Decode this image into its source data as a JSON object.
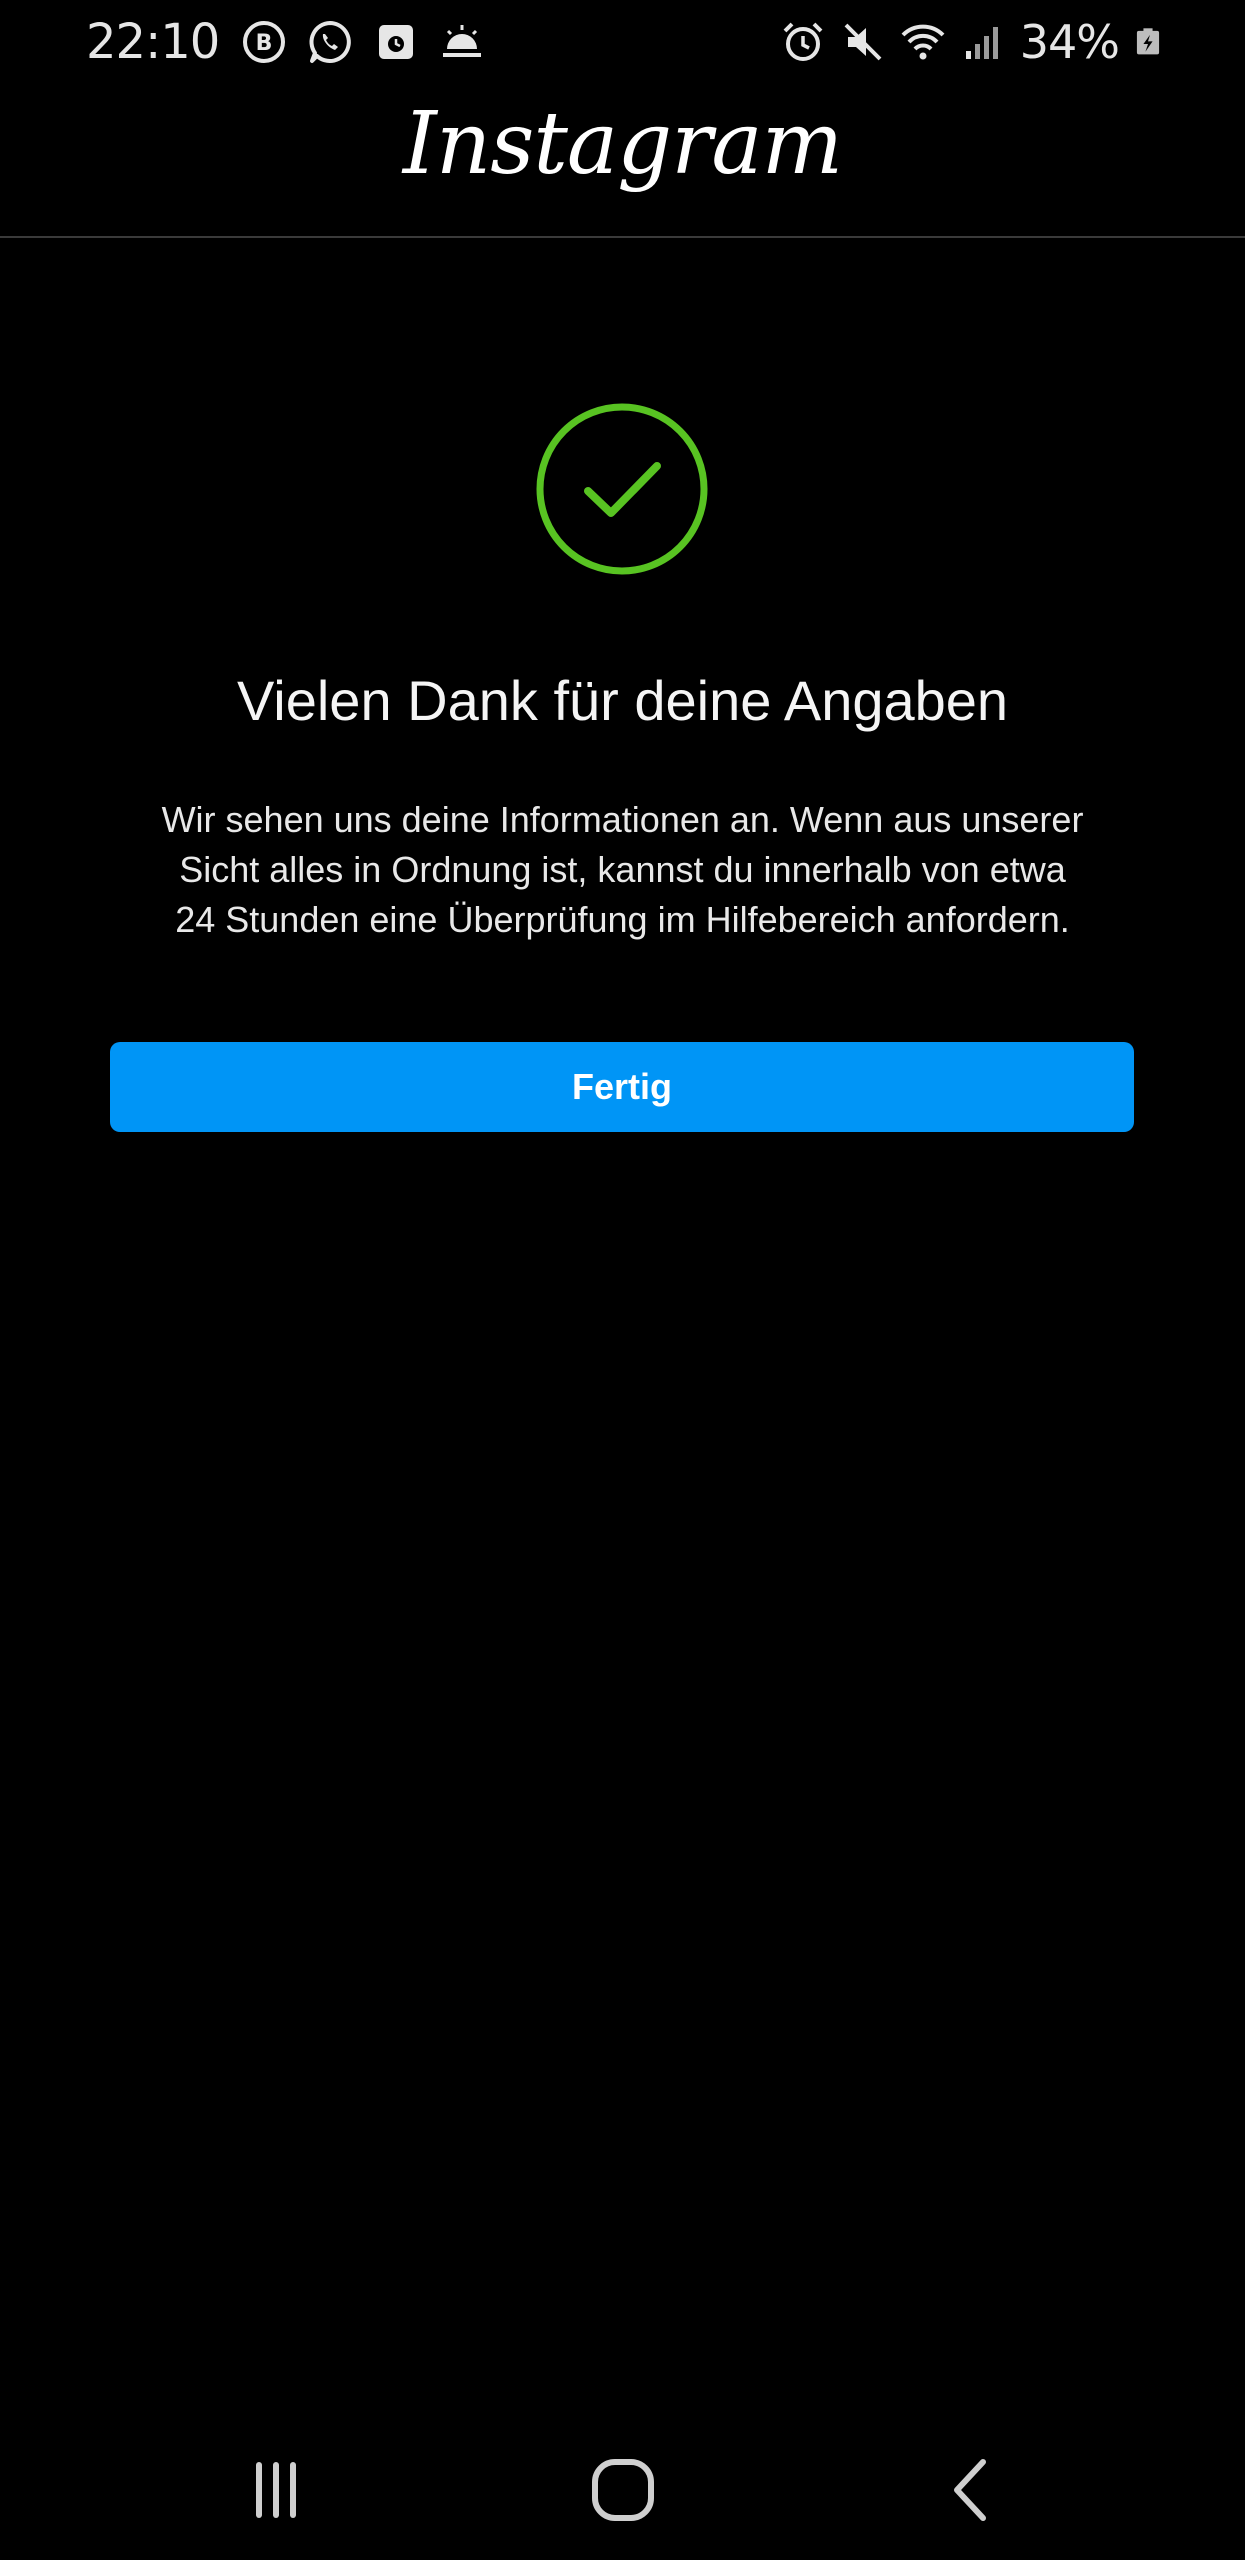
{
  "status_bar": {
    "time": "22:10",
    "battery": "34%",
    "left_icons": [
      "b-badge-icon",
      "whatsapp-icon",
      "calendar-icon",
      "weather-sunrise-icon"
    ],
    "right_icons": [
      "alarm-icon",
      "mute-icon",
      "wifi-icon",
      "signal-icon",
      "battery-charging-icon"
    ]
  },
  "header": {
    "logo": "Instagram"
  },
  "main": {
    "icon": "check-circle-icon",
    "title": "Vielen Dank für deine Angaben",
    "body_lines": [
      "Wir sehen uns deine Informationen an. Wenn aus unserer",
      "Sicht alles in Ordnung ist, kannst du innerhalb von etwa",
      "24 Stunden eine Überprüfung im Hilfebereich anfordern."
    ],
    "button_label": "Fertig"
  },
  "nav_bar": {
    "buttons": [
      "recent-apps-icon",
      "home-icon",
      "back-icon"
    ]
  },
  "colors": {
    "background": "#000000",
    "accent": "#0095f6",
    "success": "#58c322",
    "text": "#ffffff"
  }
}
